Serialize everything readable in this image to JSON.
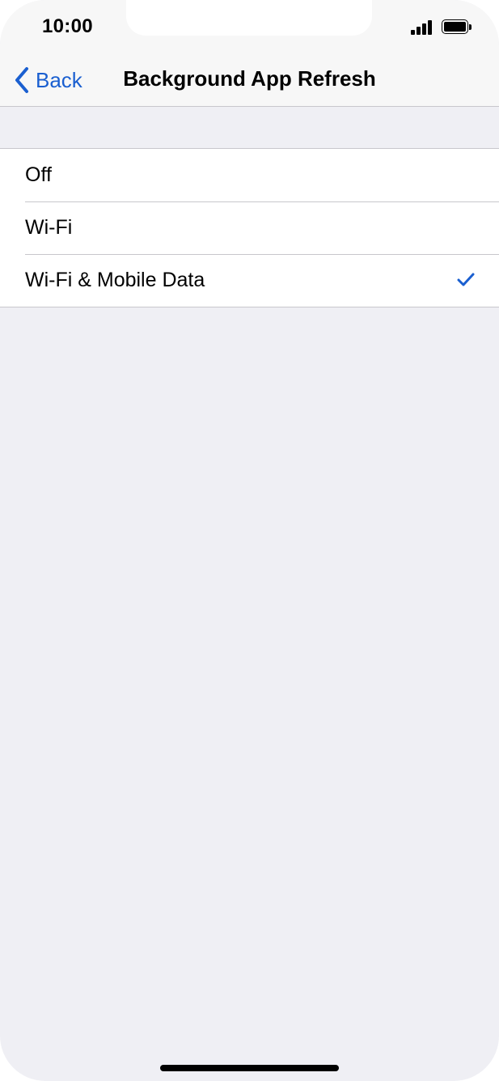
{
  "status_bar": {
    "time": "10:00",
    "signal_icon": "signal-bars-icon",
    "battery_icon": "battery-full-icon"
  },
  "nav": {
    "back_label": "Back",
    "back_icon": "chevron-left-icon",
    "title": "Background App Refresh"
  },
  "options": [
    {
      "label": "Off",
      "selected": false
    },
    {
      "label": "Wi-Fi",
      "selected": false
    },
    {
      "label": "Wi-Fi & Mobile Data",
      "selected": true
    }
  ],
  "colors": {
    "accent": "#1a5fd0",
    "background": "#efeff4",
    "separator": "#c8c7cc"
  }
}
